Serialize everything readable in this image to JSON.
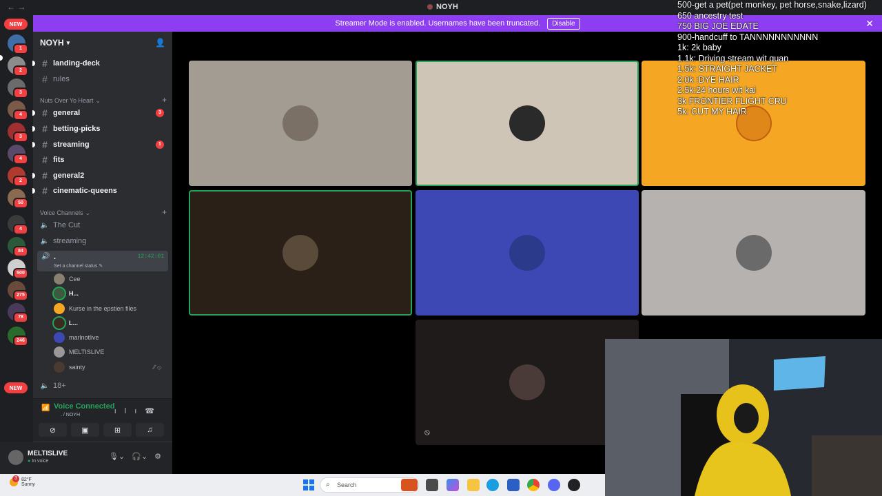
{
  "window": {
    "title": "NOYH"
  },
  "banner": {
    "text": "Streamer Mode is enabled. Usernames have been truncated.",
    "button": "Disable"
  },
  "rail": {
    "new_top": "NEW",
    "new_bottom": "NEW",
    "badges": [
      "1",
      "2",
      "3",
      "4",
      "3",
      "4",
      "2",
      "50",
      "4",
      "84",
      "500",
      "275",
      "78",
      "246"
    ]
  },
  "server": {
    "name": "NOYH",
    "channels_top": [
      {
        "name": "landing-deck"
      },
      {
        "name": "rules"
      }
    ],
    "category_text": "Nuts Over Yo Heart",
    "text_channels": [
      {
        "name": "general",
        "count": "3"
      },
      {
        "name": "betting-picks",
        "count": ""
      },
      {
        "name": "streaming",
        "count": "1"
      },
      {
        "name": "fits",
        "count": ""
      },
      {
        "name": "general2",
        "count": ""
      },
      {
        "name": "cinematic-queens",
        "count": ""
      }
    ],
    "category_voice": "Voice Channels",
    "voice_channels": [
      {
        "name": "The Cut"
      },
      {
        "name": "streaming"
      }
    ],
    "active_voice": {
      "name": ".",
      "status": "Set a channel status",
      "timer": "12:42:01"
    },
    "members": [
      {
        "name": "Cee",
        "bold": false
      },
      {
        "name": "H...",
        "bold": true
      },
      {
        "name": "Kurse in the epstien files",
        "bold": false
      },
      {
        "name": "L...",
        "bold": true
      },
      {
        "name": "marlnotlive",
        "bold": false
      },
      {
        "name": "MELTISLIVE",
        "bold": false
      },
      {
        "name": "sainty",
        "bold": false
      }
    ],
    "after_voice": "18+"
  },
  "voice_panel": {
    "title": "Voice Connected",
    "subtitle": ". / NOYH"
  },
  "user": {
    "name": "MELTISLIVE",
    "status": "In voice"
  },
  "tiles_colors": [
    "#a39c93",
    "#cfc5b7",
    "#f5a623",
    "#2a2017",
    "#3d48b5",
    "#b6b2b0",
    "#1e1b1a"
  ],
  "overlay_goals": [
    "500-get a pet(pet monkey, pet horse,snake,lizard)",
    "650 ancestry test",
    "750 BIG JOE EDATE",
    "900-handcuff to TANNNNNNNNNNN",
    "1k: 2k baby",
    "1.1k: Driving stream wit quan",
    "1.5k: STRAIGHT JACKET",
    "2.0k :DYE HAIR",
    "2.5k:24 hours wit kai",
    "3k FRONTIER FLIGHT CRU",
    "5k: CUT MY HAIR"
  ],
  "taskbar": {
    "weather_temp": "82°F",
    "weather_desc": "Sunny",
    "search_placeholder": "Search",
    "weather_badge": "3"
  }
}
